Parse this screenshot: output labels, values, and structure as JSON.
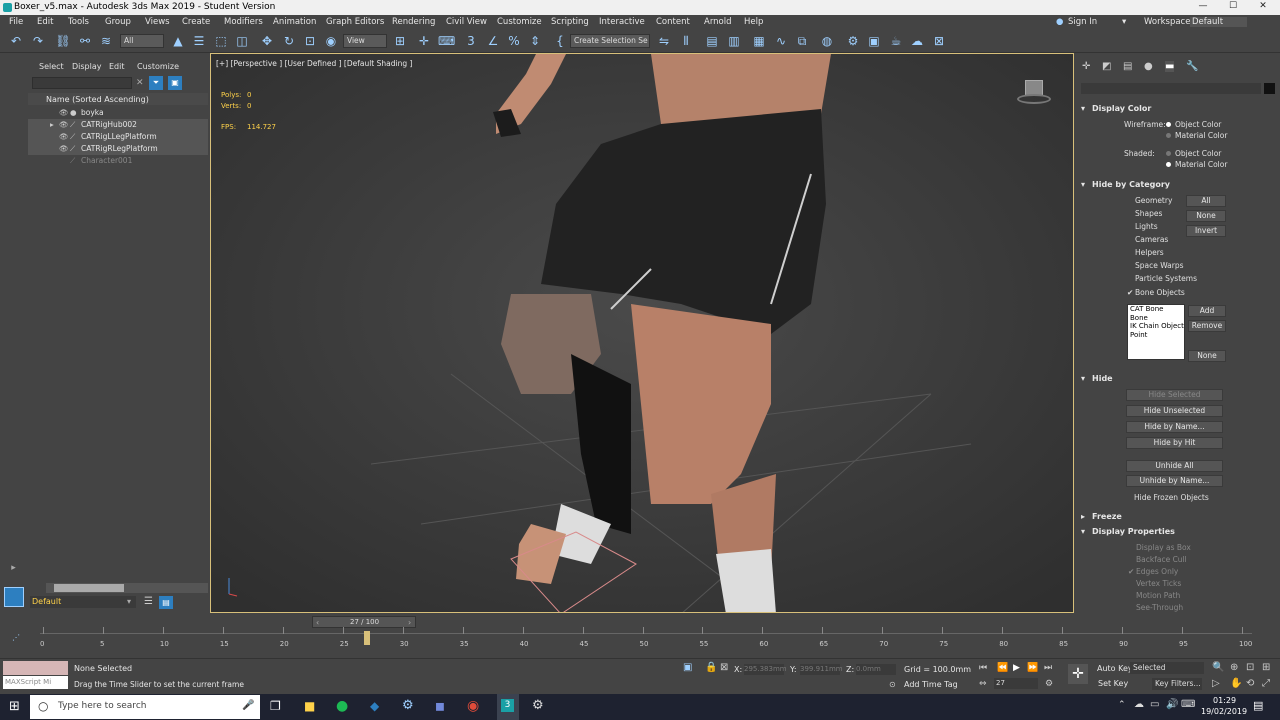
{
  "window": {
    "title": "Boxer_v5.max - Autodesk 3ds Max 2019 - Student Version",
    "min": "—",
    "max": "☐",
    "close": "✕"
  },
  "menu": {
    "items": [
      "File",
      "Edit",
      "Tools",
      "Group",
      "Views",
      "Create",
      "Modifiers",
      "Animation",
      "Graph Editors",
      "Rendering",
      "Civil View",
      "Customize",
      "Scripting",
      "Interactive",
      "Content",
      "Arnold",
      "Help"
    ],
    "sign_in": "Sign In",
    "workspaces_label": "Workspaces:",
    "workspaces_value": "Default"
  },
  "toolbar": {
    "filter_value": "All",
    "ref_coord_value": "View",
    "selection_set_placeholder": "Create Selection Se"
  },
  "scene_explorer": {
    "tabs": [
      "Select",
      "Display",
      "Edit",
      "Customize"
    ],
    "column_header": "Name (Sorted Ascending)",
    "items": [
      {
        "name": "boyka",
        "greyed": false
      },
      {
        "name": "CATRigHub002",
        "greyed": false
      },
      {
        "name": "CATRigLLegPlatform",
        "greyed": false
      },
      {
        "name": "CATRigRLegPlatform",
        "greyed": false
      },
      {
        "name": "Character001",
        "greyed": true
      }
    ],
    "layer_value": "Default"
  },
  "viewport": {
    "label": "[+] [Perspective ] [User Defined ] [Default Shading ]",
    "stats": {
      "polys_label": "Polys:",
      "polys_value": "0",
      "verts_label": "Verts:",
      "verts_value": "0",
      "fps_label": "FPS:",
      "fps_value": "114.727"
    }
  },
  "command_panel": {
    "display_color": {
      "title": "Display Color",
      "wireframe_label": "Wireframe:",
      "shaded_label": "Shaded:",
      "object_color": "Object Color",
      "material_color": "Material Color"
    },
    "hide_by_category": {
      "title": "Hide by Category",
      "categories": [
        "Geometry",
        "Shapes",
        "Lights",
        "Cameras",
        "Helpers",
        "Space Warps",
        "Particle Systems",
        "Bone Objects"
      ],
      "buttons": [
        "All",
        "None",
        "Invert"
      ],
      "list_items": [
        "CAT Bone",
        "Bone",
        "IK Chain Object",
        "Point"
      ],
      "add": "Add",
      "remove": "Remove",
      "none": "None"
    },
    "hide": {
      "title": "Hide",
      "buttons": [
        "Hide Selected",
        "Hide Unselected",
        "Hide by Name...",
        "Hide by Hit",
        "Unhide All",
        "Unhide by Name..."
      ],
      "hide_frozen": "Hide Frozen Objects"
    },
    "freeze": {
      "title": "Freeze"
    },
    "display_properties": {
      "title": "Display Properties",
      "items": [
        "Display as Box",
        "Backface Cull",
        "Edges Only",
        "Vertex Ticks",
        "Motion Path",
        "See-Through"
      ]
    }
  },
  "timeline": {
    "slider_label": "27 / 100",
    "current_frame": 27,
    "total_frames": 100,
    "tick_labels": [
      "0",
      "5",
      "10",
      "15",
      "20",
      "25",
      "30",
      "35",
      "40",
      "45",
      "50",
      "55",
      "60",
      "65",
      "70",
      "75",
      "80",
      "85",
      "90",
      "95",
      "100"
    ]
  },
  "status": {
    "selection": "None Selected",
    "prompt": "Drag the Time Slider to set the current frame",
    "maxscript": "MAXScript Mi",
    "x_label": "X:",
    "x_value": "295.383mm",
    "y_label": "Y:",
    "y_value": "399.911mm",
    "z_label": "Z:",
    "z_value": "0.0mm",
    "grid": "Grid = 100.0mm",
    "add_time_tag": "Add Time Tag",
    "auto_key": "Auto Key",
    "set_key": "Set Key",
    "selected_value": "Selected",
    "key_filters": "Key Filters...",
    "frame_value": "27"
  },
  "taskbar": {
    "search_placeholder": "Type here to search",
    "time": "01:29",
    "date": "19/02/2019"
  },
  "colors": {
    "accent": "#d8c07a",
    "ui_bg": "#444444",
    "viewport_bg": "#3b3b3b",
    "icon_blue": "#9fd0ff",
    "taskbar_bg": "#1e2230"
  }
}
